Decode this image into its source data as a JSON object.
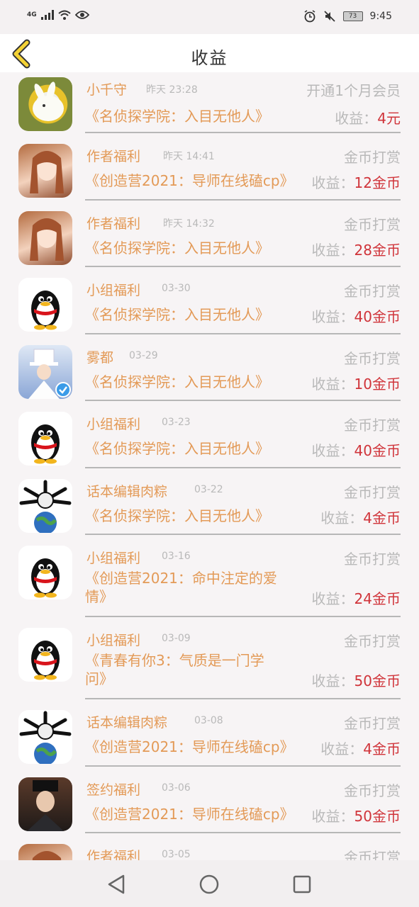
{
  "status": {
    "network": "4G",
    "battery": "73",
    "time": "9:45"
  },
  "header": {
    "title": "收益"
  },
  "rows": [
    {
      "name": "小千守",
      "time": "昨天 23:28",
      "type": "开通1个月会员",
      "book": "《名侦探学院：入目无他人》",
      "earn_label": "收益：",
      "amount": "4元"
    },
    {
      "name": "作者福利",
      "time": "昨天 14:41",
      "type": "金币打赏",
      "book": "《创造营2021：导师在线磕cp》",
      "earn_label": "收益：",
      "amount": "12金币"
    },
    {
      "name": "作者福利",
      "time": "昨天 14:32",
      "type": "金币打赏",
      "book": "《名侦探学院：入目无他人》",
      "earn_label": "收益：",
      "amount": "28金币"
    },
    {
      "name": "小组福利",
      "time": "03-30",
      "type": "金币打赏",
      "book": "《名侦探学院：入目无他人》",
      "earn_label": "收益：",
      "amount": "40金币"
    },
    {
      "name": "雾都",
      "time": "03-29",
      "type": "金币打赏",
      "book": "《名侦探学院：入目无他人》",
      "earn_label": "收益：",
      "amount": "10金币"
    },
    {
      "name": "小组福利",
      "time": "03-23",
      "type": "金币打赏",
      "book": "《名侦探学院：入目无他人》",
      "earn_label": "收益：",
      "amount": "40金币"
    },
    {
      "name": "话本编辑肉粽",
      "time": "03-22",
      "type": "金币打赏",
      "book": "《名侦探学院：入目无他人》",
      "earn_label": "收益：",
      "amount": "4金币"
    },
    {
      "name": "小组福利",
      "time": "03-16",
      "type": "金币打赏",
      "book_l1": "《创造营2021：命中注定的爱",
      "book_l2": "情》",
      "earn_label": "收益：",
      "amount": "24金币"
    },
    {
      "name": "小组福利",
      "time": "03-09",
      "type": "金币打赏",
      "book_l1": "《青春有你3：气质是一门学",
      "book_l2": "问》",
      "earn_label": "收益：",
      "amount": "50金币"
    },
    {
      "name": "话本编辑肉粽",
      "time": "03-08",
      "type": "金币打赏",
      "book": "《创造营2021：导师在线磕cp》",
      "earn_label": "收益：",
      "amount": "4金币"
    },
    {
      "name": "签约福利",
      "time": "03-06",
      "type": "金币打赏",
      "book": "《创造营2021：导师在线磕cp》",
      "earn_label": "收益：",
      "amount": "50金币"
    },
    {
      "name": "作者福利",
      "time": "03-05",
      "type": "金币打赏"
    }
  ]
}
